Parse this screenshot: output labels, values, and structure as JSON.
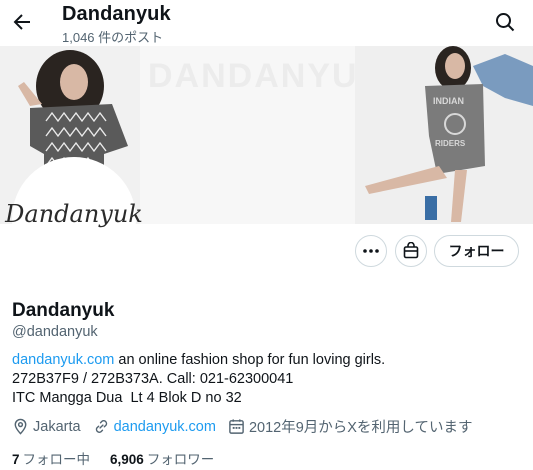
{
  "header": {
    "title": "Dandanyuk",
    "post_count": "1,046 件のポスト"
  },
  "banner": {
    "center_text": "DANDANYUK"
  },
  "avatar": {
    "text": "Dandanyuk"
  },
  "actions": {
    "follow_label": "フォロー"
  },
  "profile": {
    "name": "Dandanyuk",
    "handle": "@dandanyuk",
    "bio_link": "dandanyuk.com",
    "bio_line1": " an online fashion shop for fun loving girls.",
    "bio_line2": "272B37F9 / 272B373A. Call: 021-62300041",
    "bio_line3": "ITC Mangga Dua  Lt 4 Blok D no 32",
    "location": "Jakarta",
    "website": "dandanyuk.com",
    "joined": "2012年9月からXを利用しています",
    "following_count": "7",
    "following_label": "フォロー中",
    "followers_count": "6,906",
    "followers_label": "フォロワー"
  },
  "icons": [
    "back-arrow-icon",
    "search-icon",
    "more-icon",
    "shop-icon",
    "location-icon",
    "link-icon",
    "calendar-icon"
  ]
}
